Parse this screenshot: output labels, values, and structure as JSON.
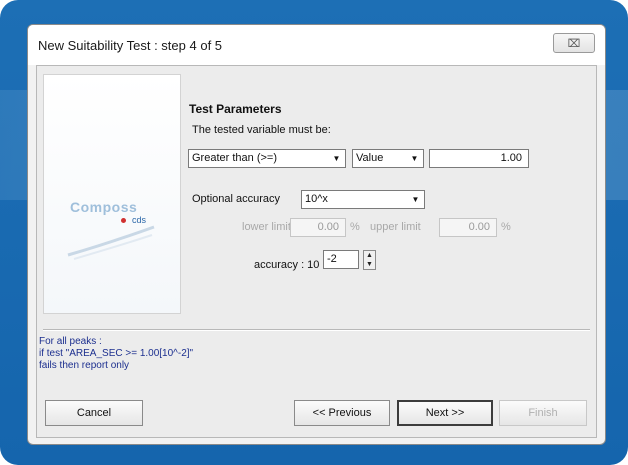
{
  "dialog": {
    "title": "New Suitability Test : step 4 of 5",
    "close_glyph": "⌧"
  },
  "logo": {
    "word": "Composs",
    "sub": "cds"
  },
  "params": {
    "section_title": "Test Parameters",
    "instruction": "The tested variable must be:",
    "comparison": "Greater than (>=)",
    "value_type": "Value",
    "value": "1.00",
    "optional_accuracy_label": "Optional accuracy",
    "accuracy_mode": "10^x",
    "lower_limit_label": "lower limit",
    "lower_limit_value": "0.00",
    "lower_unit": "%",
    "upper_limit_label": "upper limit",
    "upper_limit_value": "0.00",
    "upper_unit": "%",
    "accuracy_label": "accuracy : 10",
    "accuracy_exponent": "-2"
  },
  "summary": {
    "line1": "For  all peaks :",
    "line2": "if test \"AREA_SEC >= 1.00[10^-2]\"",
    "line3": "fails then report only"
  },
  "buttons": {
    "cancel": "Cancel",
    "previous": "<< Previous",
    "next": "Next >>",
    "finish": "Finish"
  }
}
